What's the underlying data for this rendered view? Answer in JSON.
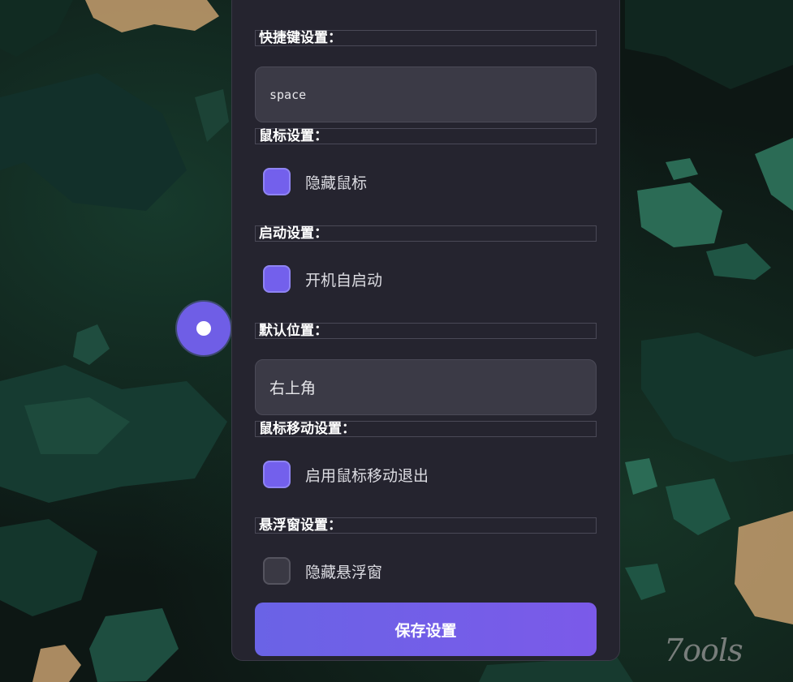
{
  "shortcut_section": {
    "label": "快捷键设置：",
    "value": "space"
  },
  "mouse_section": {
    "label": "鼠标设置：",
    "hide_mouse": {
      "label": "隐藏鼠标",
      "checked": true
    }
  },
  "startup_section": {
    "label": "启动设置：",
    "autostart": {
      "label": "开机自启动",
      "checked": true
    }
  },
  "position_section": {
    "label": "默认位置：",
    "value": "右上角"
  },
  "mouse_move_section": {
    "label": "鼠标移动设置：",
    "exit_on_move": {
      "label": "启用鼠标移动退出",
      "checked": true
    }
  },
  "float_window_section": {
    "label": "悬浮窗设置：",
    "hide_float_window": {
      "label": "隐藏悬浮窗",
      "checked": false
    }
  },
  "save_button": {
    "label": "保存设置"
  },
  "watermark": {
    "text": "7ools"
  },
  "colors": {
    "accent": "#7360ec",
    "panel_bg": "#25242f",
    "input_bg": "#3b3a46",
    "background": "#0d1714"
  },
  "icons": {
    "float_ball": "circle-dot-icon"
  }
}
